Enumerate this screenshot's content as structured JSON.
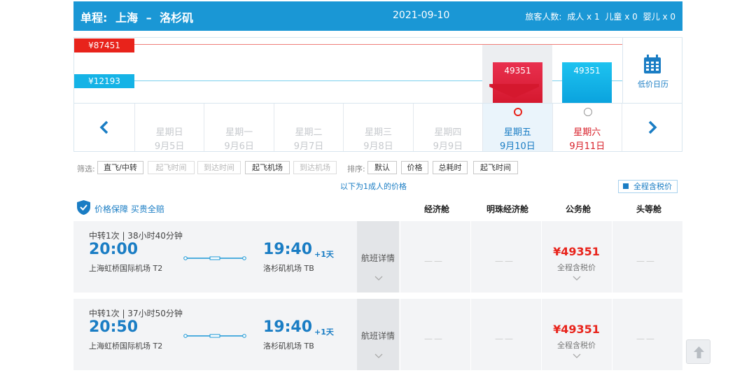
{
  "header": {
    "trip_type": "单程:",
    "origin": "上海",
    "separator": "–",
    "destination": "洛杉矶",
    "date": "2021-09-10",
    "passengers_label": "旅客人数:",
    "adults": "成人 x 1",
    "children": "儿童 x 0",
    "infants": "婴儿 x 0"
  },
  "price_chart": {
    "high_price": "¥87451",
    "low_price": "¥12193",
    "bars": [
      {
        "day": "星期五",
        "price": "49351",
        "color": "#d5182e"
      },
      {
        "day": "星期六",
        "price": "49351",
        "color": "#0aa3de"
      }
    ],
    "calendar_label": "低价日历"
  },
  "days": [
    {
      "weekday": "星期日",
      "date": "9月5日"
    },
    {
      "weekday": "星期一",
      "date": "9月6日"
    },
    {
      "weekday": "星期二",
      "date": "9月7日"
    },
    {
      "weekday": "星期三",
      "date": "9月8日"
    },
    {
      "weekday": "星期四",
      "date": "9月9日"
    },
    {
      "weekday": "星期五",
      "date": "9月10日"
    },
    {
      "weekday": "星期六",
      "date": "9月11日"
    }
  ],
  "filters": {
    "filter_label": "筛选:",
    "filter_buttons": [
      "直飞/中转",
      "起飞时间",
      "到达时间",
      "起飞机场",
      "到达机场"
    ],
    "sort_label": "排序:",
    "sort_buttons": [
      "默认",
      "价格",
      "总耗时",
      "起飞时间"
    ]
  },
  "per_adult_note": "以下为1成人的价格",
  "tax_toggle": "全程含税价",
  "guarantee": {
    "text1": "价格保障",
    "text2": "买贵全赔"
  },
  "cabins": [
    "经济舱",
    "明珠经济舱",
    "公务舱",
    "头等舱"
  ],
  "flights": [
    {
      "transfer": "中转1次 | 38小时40分钟",
      "dep_time": "20:00",
      "dep_airport": "上海虹桥国际机场 T2",
      "arr_time": "19:40",
      "plus_day": "+1天",
      "arr_airport": "洛杉矶机场 TB",
      "details": "航班详情",
      "economy": "——",
      "premium": "——",
      "business_price": "¥49351",
      "business_sub": "全程含税价",
      "first": "——"
    },
    {
      "transfer": "中转1次 | 37小时50分钟",
      "dep_time": "20:50",
      "dep_airport": "上海虹桥国际机场 T2",
      "arr_time": "19:40",
      "plus_day": "+1天",
      "arr_airport": "洛杉矶机场 TB",
      "details": "航班详情",
      "economy": "——",
      "premium": "——",
      "business_price": "¥49351",
      "business_sub": "全程含税价",
      "first": "——"
    }
  ],
  "colors": {
    "brand_blue": "#1a97d5",
    "price_red": "#e8231b"
  }
}
